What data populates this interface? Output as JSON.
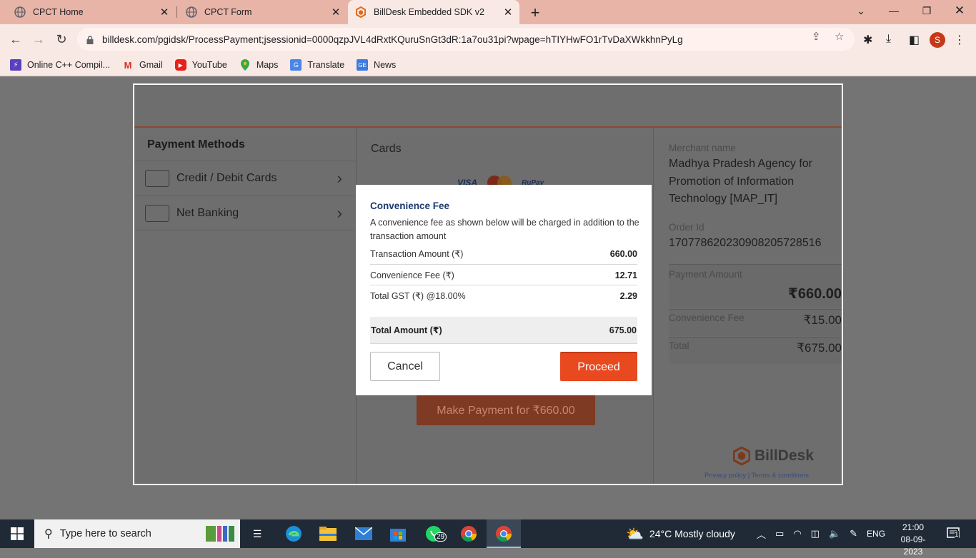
{
  "browser": {
    "tabs": [
      {
        "label": "CPCT Home"
      },
      {
        "label": "CPCT Form"
      },
      {
        "label": "BillDesk Embedded SDK v2"
      }
    ],
    "url": "billdesk.com/pgidsk/ProcessPayment;jsessionid=0000qzpJVL4dRxtKQuruSnGt3dR:1a7ou31pi?wpage=hTIYHwFO1rTvDaXWkkhnPyLg",
    "profile_initial": "S",
    "bookmarks": [
      {
        "label": "Online C++ Compil...",
        "icon": "compiler-icon"
      },
      {
        "label": "Gmail",
        "icon": "gmail-icon"
      },
      {
        "label": "YouTube",
        "icon": "youtube-icon"
      },
      {
        "label": "Maps",
        "icon": "maps-icon"
      },
      {
        "label": "Translate",
        "icon": "translate-icon"
      },
      {
        "label": "News",
        "icon": "news-icon"
      }
    ]
  },
  "payment_methods": {
    "title": "Payment Methods",
    "items": [
      {
        "label": "Credit / Debit Cards"
      },
      {
        "label": "Net Banking"
      }
    ]
  },
  "cards": {
    "title": "Cards",
    "logos": [
      "VISA",
      "RuPay"
    ],
    "make_payment_label": "Make Payment for ₹660.00"
  },
  "summary": {
    "merchant_label": "Merchant name",
    "merchant_value": "Madhya Pradesh Agency for Promotion of Information Technology [MAP_IT]",
    "order_label": "Order Id",
    "order_value": "17077862023090820572851​6",
    "payment_amount_label": "Payment Amount",
    "payment_amount_value": "₹660.00",
    "convenience_label": "Convenience Fee",
    "convenience_value": "₹15.00",
    "total_label": "Total",
    "total_value": "₹675.00",
    "brand": "BillDesk",
    "privacy": "Privacy policy | Terms & conditions"
  },
  "modal": {
    "title": "Convenience Fee",
    "description": "A convenience fee as shown below will be charged in addition to the transaction amount",
    "rows": [
      {
        "label": "Transaction Amount (₹)",
        "value": "660.00"
      },
      {
        "label": "Convenience Fee (₹)",
        "value": "12.71"
      },
      {
        "label": "Total GST (₹) @18.00%",
        "value": "2.29"
      }
    ],
    "total_label": "Total Amount (₹)",
    "total_value": "675.00",
    "cancel_label": "Cancel",
    "proceed_label": "Proceed",
    "accent_color": "#e8491f"
  },
  "taskbar": {
    "search_placeholder": "Type here to search",
    "whatsapp_badge": "29",
    "weather": "24°C  Mostly cloudy",
    "language": "ENG",
    "time": "21:00",
    "date": "08-09-2023",
    "notification_count": "1"
  }
}
